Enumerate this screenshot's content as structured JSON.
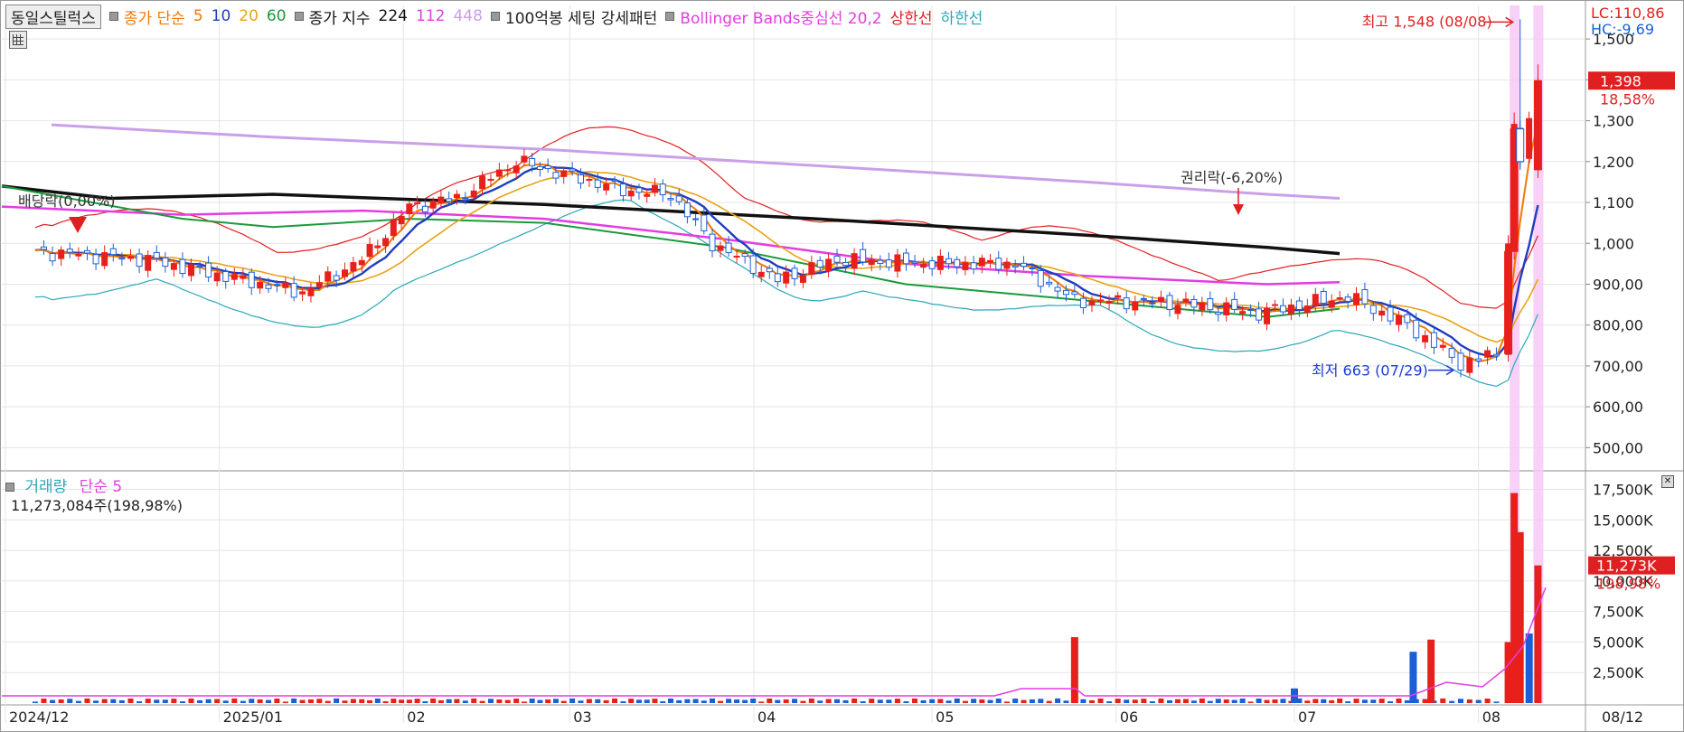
{
  "legend": {
    "stock_name": "동일스틸럭스",
    "ma_label": "종가 단순",
    "ma_periods": [
      {
        "label": "5",
        "color": "#f07a00"
      },
      {
        "label": "10",
        "color": "#1f3dbf"
      },
      {
        "label": "20",
        "color": "#e8a317"
      },
      {
        "label": "60",
        "color": "#1a9a3a"
      }
    ],
    "ema_label": "종가 지수",
    "ema_periods": [
      {
        "label": "224",
        "color": "#111111"
      },
      {
        "label": "112",
        "color": "#e23de2"
      },
      {
        "label": "448",
        "color": "#c9a0e8"
      }
    ],
    "pattern_label": "100억봉 세팅 강세패턴",
    "bb_label": "Bollinger Bands중심선 20,2",
    "bb_upper_label": "상한선",
    "bb_lower_label": "하한선",
    "bb_color": "#e23de2",
    "bb_upper_color": "#e02020",
    "bb_lower_color": "#2aa8b8"
  },
  "volume_legend": {
    "label": "거래량",
    "ma_label": "단순 5",
    "info": "11,273,084주(198,98%)"
  },
  "price_axis": {
    "ticks": [
      "1,500",
      "1,400",
      "1,300",
      "1,200",
      "1,100",
      "1,000",
      "900,00",
      "800,00",
      "700,00",
      "600,00",
      "500,00"
    ],
    "lc": "LC:110,86",
    "hc": "HC:-9,69",
    "current_price": "1,398",
    "current_change": "18,58%"
  },
  "volume_axis": {
    "ticks": [
      "17,500K",
      "15,000K",
      "12,500K",
      "10,000K",
      "7,500K",
      "5,000K",
      "2,500K"
    ],
    "current": "11,273K",
    "current_pct": "198,98%"
  },
  "x_axis": {
    "labels": [
      "2024/12",
      "2025/01",
      "02",
      "03",
      "04",
      "05",
      "06",
      "07",
      "08",
      "08/12"
    ]
  },
  "annotations": {
    "high": "최고 1,548 (08/08)",
    "low": "최저 663 (07/29)",
    "dividend": "배당락(0,00%)",
    "rights": "권리락(-6,20%)"
  },
  "colors": {
    "up": "#e8201c",
    "down": "#1a5fd8",
    "highlight": "#f7c8f7"
  },
  "chart_data": {
    "type": "candlestick",
    "title": "",
    "ylim": [
      450,
      1560
    ],
    "volume_ylim": [
      0,
      18500000
    ],
    "price_anchors": [
      {
        "date": "2024-12-01",
        "close": 980
      },
      {
        "date": "2024-12-20",
        "close": 960
      },
      {
        "date": "2025-01-05",
        "close": 910
      },
      {
        "date": "2025-01-15",
        "close": 880
      },
      {
        "date": "2025-01-25",
        "close": 960
      },
      {
        "date": "2025-02-02",
        "close": 1090
      },
      {
        "date": "2025-02-10",
        "close": 1110
      },
      {
        "date": "2025-02-20",
        "close": 1200
      },
      {
        "date": "2025-02-28",
        "close": 1170
      },
      {
        "date": "2025-03-10",
        "close": 1130
      },
      {
        "date": "2025-03-18",
        "close": 1120
      },
      {
        "date": "2025-03-25",
        "close": 1000
      },
      {
        "date": "2025-04-05",
        "close": 910
      },
      {
        "date": "2025-04-15",
        "close": 960
      },
      {
        "date": "2025-05-01",
        "close": 950
      },
      {
        "date": "2025-05-15",
        "close": 950
      },
      {
        "date": "2025-05-25",
        "close": 860
      },
      {
        "date": "2025-06-10",
        "close": 855
      },
      {
        "date": "2025-06-25",
        "close": 830
      },
      {
        "date": "2025-07-10",
        "close": 870
      },
      {
        "date": "2025-07-20",
        "close": 800
      },
      {
        "date": "2025-07-29",
        "close": 705
      },
      {
        "date": "2025-08-04",
        "close": 730
      },
      {
        "date": "2025-08-06",
        "close": 1000
      },
      {
        "date": "2025-08-07",
        "close": 1280
      },
      {
        "date": "2025-08-08",
        "close": 1200
      },
      {
        "date": "2025-08-11",
        "close": 1398
      }
    ],
    "high": {
      "date": "2025-08-08",
      "value": 1548
    },
    "low": {
      "date": "2025-07-29",
      "value": 663
    },
    "ema224": [
      [
        0,
        1140
      ],
      [
        120,
        1110
      ],
      [
        300,
        1120
      ],
      [
        600,
        1095
      ],
      [
        900,
        1060
      ],
      [
        1200,
        1020
      ],
      [
        1400,
        990
      ],
      [
        1480,
        975
      ]
    ],
    "ema448": [
      [
        55,
        1290
      ],
      [
        300,
        1260
      ],
      [
        600,
        1230
      ],
      [
        900,
        1190
      ],
      [
        1200,
        1150
      ],
      [
        1400,
        1120
      ],
      [
        1480,
        1110
      ]
    ],
    "ema112": [
      [
        0,
        1090
      ],
      [
        200,
        1070
      ],
      [
        400,
        1080
      ],
      [
        600,
        1060
      ],
      [
        800,
        1010
      ],
      [
        1000,
        950
      ],
      [
        1200,
        920
      ],
      [
        1400,
        900
      ],
      [
        1480,
        905
      ]
    ],
    "ma60": [
      [
        0,
        1140
      ],
      [
        200,
        1060
      ],
      [
        300,
        1040
      ],
      [
        450,
        1060
      ],
      [
        600,
        1050
      ],
      [
        800,
        990
      ],
      [
        1000,
        900
      ],
      [
        1200,
        860
      ],
      [
        1400,
        820
      ],
      [
        1480,
        840
      ]
    ],
    "volume_spikes": [
      {
        "date": "2025-05-25",
        "value": 5400000,
        "dir": "up"
      },
      {
        "date": "2025-07-01",
        "value": 1200000,
        "dir": "down"
      },
      {
        "date": "2025-07-21",
        "value": 4200000,
        "dir": "down"
      },
      {
        "date": "2025-07-24",
        "value": 5200000,
        "dir": "up"
      },
      {
        "date": "2025-08-06",
        "value": 5000000,
        "dir": "up"
      },
      {
        "date": "2025-08-07",
        "value": 17200000,
        "dir": "up"
      },
      {
        "date": "2025-08-08",
        "value": 14000000,
        "dir": "up"
      },
      {
        "date": "2025-08-08b",
        "value": 5700000,
        "dir": "down"
      },
      {
        "date": "2025-08-11",
        "value": 11273084,
        "dir": "up"
      }
    ]
  }
}
